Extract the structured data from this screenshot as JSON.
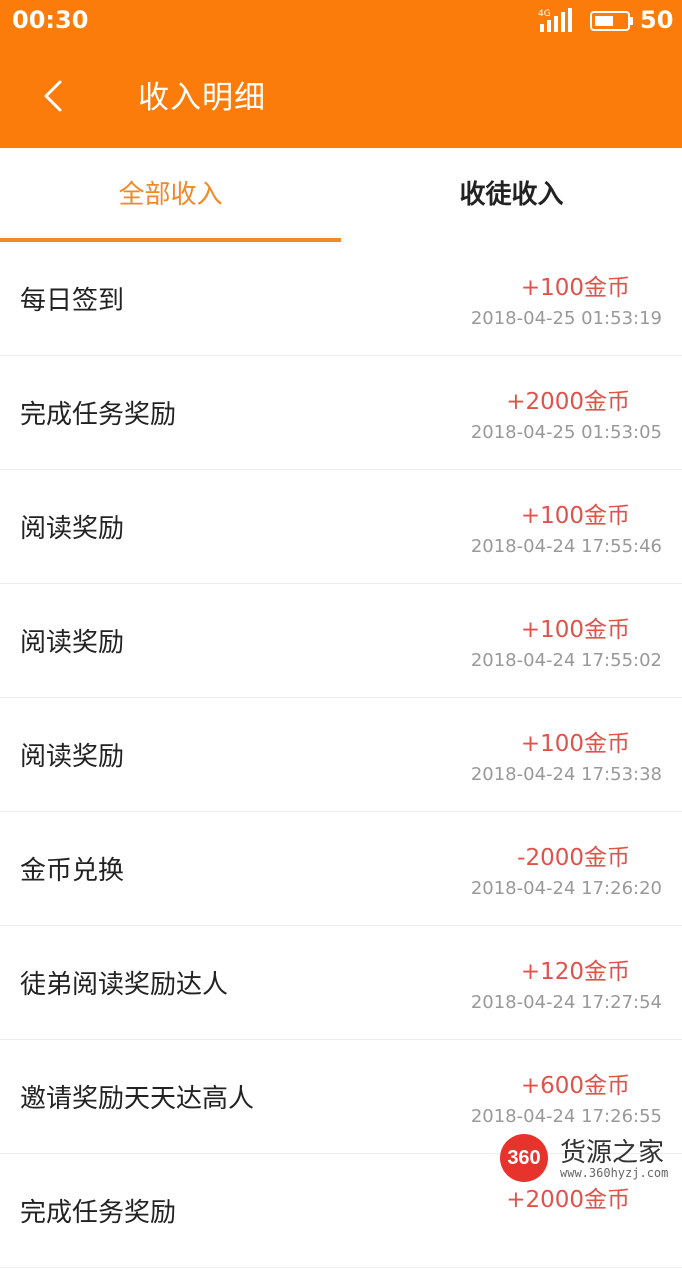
{
  "status_bar": {
    "time": "00:30",
    "network": "4G",
    "battery": "50"
  },
  "header": {
    "title": "收入明细",
    "back_icon": "chevron-left-icon"
  },
  "tabs": [
    {
      "label": "全部收入",
      "active": true
    },
    {
      "label": "收徒收入",
      "active": false
    }
  ],
  "records": [
    {
      "label": "每日签到",
      "amount": "+100金币",
      "time": "2018-04-25 01:53:19"
    },
    {
      "label": "完成任务奖励",
      "amount": "+2000金币",
      "time": "2018-04-25 01:53:05"
    },
    {
      "label": "阅读奖励",
      "amount": "+100金币",
      "time": "2018-04-24 17:55:46"
    },
    {
      "label": "阅读奖励",
      "amount": "+100金币",
      "time": "2018-04-24 17:55:02"
    },
    {
      "label": "阅读奖励",
      "amount": "+100金币",
      "time": "2018-04-24 17:53:38"
    },
    {
      "label": "金币兑换",
      "amount": "-2000金币",
      "time": "2018-04-24 17:26:20"
    },
    {
      "label": "徒弟阅读奖励达人",
      "amount": "+120金币",
      "time": "2018-04-24 17:27:54"
    },
    {
      "label": "邀请奖励天天达高人",
      "amount": "+600金币",
      "time": "2018-04-24 17:26:55"
    },
    {
      "label": "完成任务奖励",
      "amount": "+2000金币",
      "time": ""
    }
  ],
  "watermark": {
    "badge": "360",
    "name": "货源之家",
    "url": "www.360hyzj.com"
  },
  "colors": {
    "primary": "#fb7c0a",
    "tab_active": "#f08a28",
    "amount": "#e0524a"
  }
}
